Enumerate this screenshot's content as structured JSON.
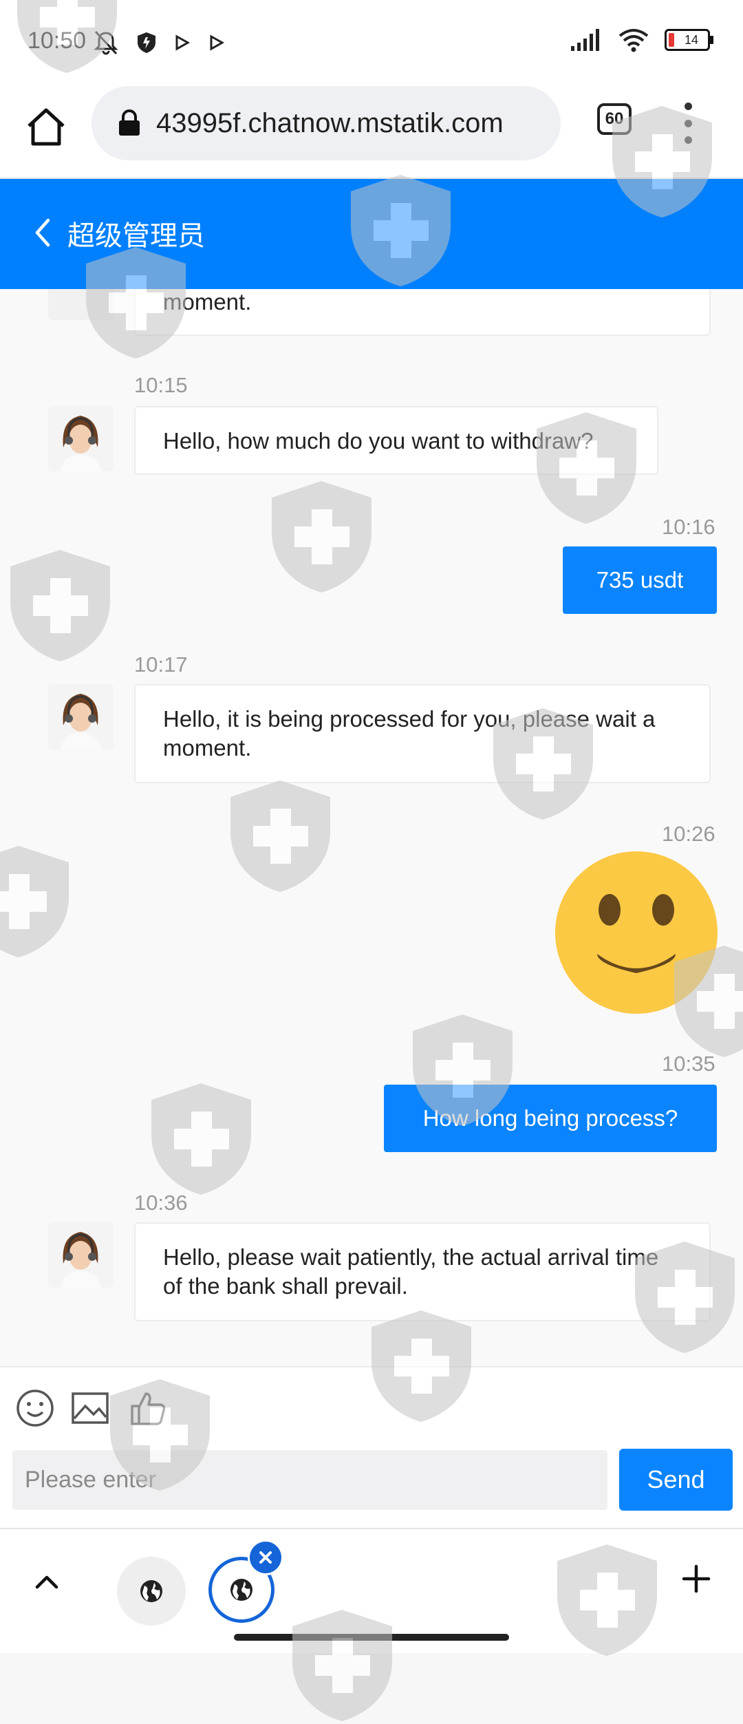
{
  "status_bar": {
    "time": "10:50",
    "battery": "14"
  },
  "browser": {
    "url": "43995f.chatnow.mstatik.com",
    "tab_count": "60"
  },
  "chat": {
    "title": "超级管理员",
    "top_partial_text": "moment.",
    "messages": [
      {
        "time": "10:15",
        "text": "Hello, how much do you want to withdraw?"
      },
      {
        "time": "10:16",
        "text": "735 usdt"
      },
      {
        "time": "10:17",
        "text": "Hello, it is being processed for you, please wait a moment."
      },
      {
        "time": "10:26",
        "text": "🙂"
      },
      {
        "time": "10:35",
        "text": "How long being process?"
      },
      {
        "time": "10:36",
        "text": "Hello, please wait patiently, the actual arrival time of the bank shall prevail."
      }
    ]
  },
  "composer": {
    "placeholder": "Please enter",
    "send_label": "Send"
  },
  "colors": {
    "accent": "#0a84ff",
    "header": "#0080ff",
    "shield": "#c8c8c8"
  }
}
